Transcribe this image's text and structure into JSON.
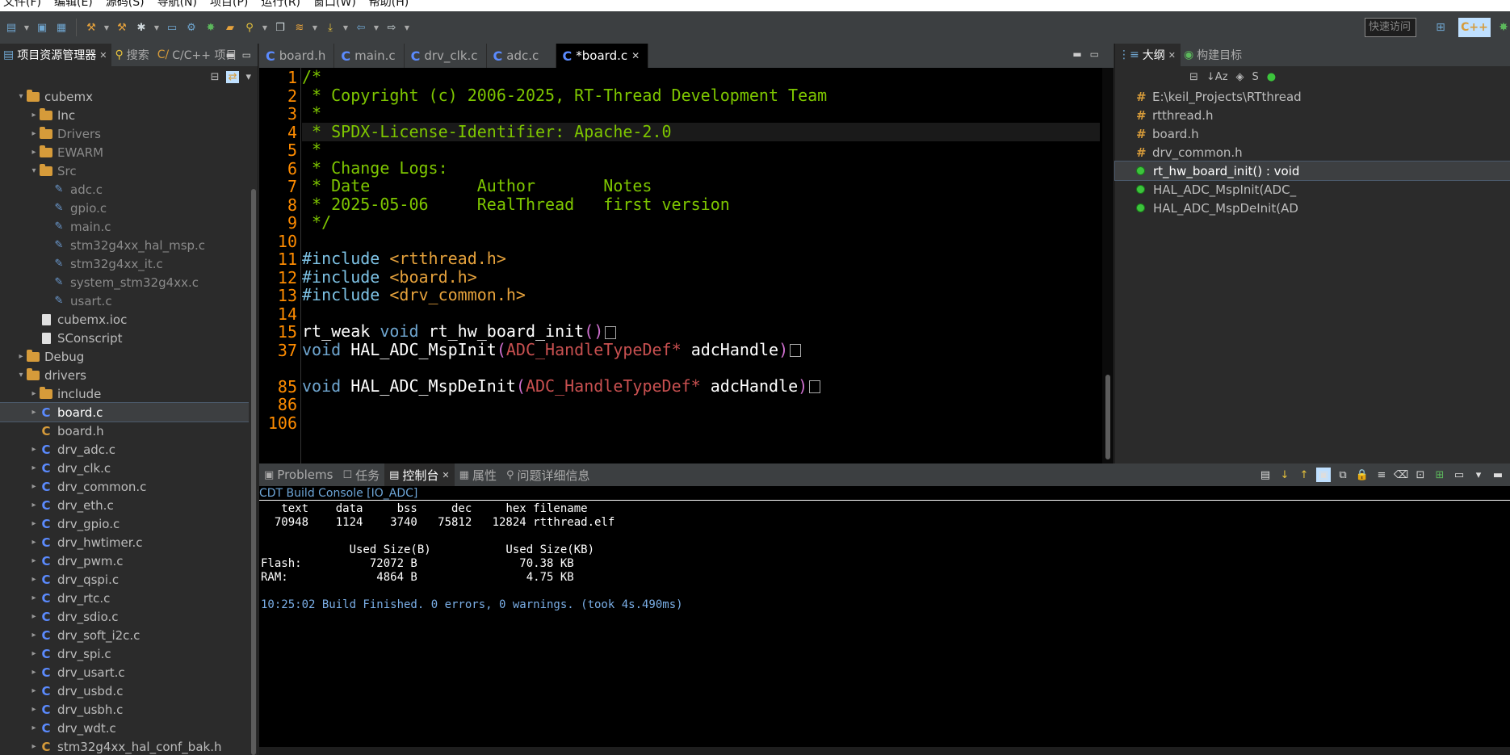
{
  "menu": [
    "文件(F)",
    "编辑(E)",
    "源码(S)",
    "导航(N)",
    "项目(P)",
    "运行(R)",
    "窗口(W)",
    "帮助(H)"
  ],
  "quick_access_placeholder": "快速访问",
  "left_panel": {
    "tabs": [
      {
        "label": "项目资源管理器",
        "active": true
      },
      {
        "label": "搜索",
        "active": false
      },
      {
        "label": "C/C++ 项目",
        "active": false
      }
    ],
    "tree": [
      {
        "label": "cubemx",
        "kind": "folder",
        "level": 1,
        "twisty": "▾"
      },
      {
        "label": "Inc",
        "kind": "folder",
        "level": 2,
        "twisty": "▸"
      },
      {
        "label": "Drivers",
        "kind": "folder",
        "level": 2,
        "twisty": "▸",
        "dim": true
      },
      {
        "label": "EWARM",
        "kind": "folder",
        "level": 2,
        "twisty": "▸",
        "dim": true
      },
      {
        "label": "Src",
        "kind": "folder",
        "level": 2,
        "twisty": "▾",
        "dim": true
      },
      {
        "label": "adc.c",
        "kind": "csrc",
        "level": 3,
        "dim": true
      },
      {
        "label": "gpio.c",
        "kind": "csrc",
        "level": 3,
        "dim": true
      },
      {
        "label": "main.c",
        "kind": "csrc",
        "level": 3,
        "dim": true
      },
      {
        "label": "stm32g4xx_hal_msp.c",
        "kind": "csrc",
        "level": 3,
        "dim": true
      },
      {
        "label": "stm32g4xx_it.c",
        "kind": "csrc",
        "level": 3,
        "dim": true
      },
      {
        "label": "system_stm32g4xx.c",
        "kind": "csrc",
        "level": 3,
        "dim": true
      },
      {
        "label": "usart.c",
        "kind": "csrc",
        "level": 3,
        "dim": true
      },
      {
        "label": "cubemx.ioc",
        "kind": "file",
        "level": 2
      },
      {
        "label": "SConscript",
        "kind": "file",
        "level": 2
      },
      {
        "label": "Debug",
        "kind": "folder",
        "level": 1,
        "twisty": "▸"
      },
      {
        "label": "drivers",
        "kind": "folder",
        "level": 1,
        "twisty": "▾"
      },
      {
        "label": "include",
        "kind": "folder",
        "level": 2,
        "twisty": "▸"
      },
      {
        "label": "board.c",
        "kind": "c",
        "level": 2,
        "twisty": "▸",
        "selected": true
      },
      {
        "label": "board.h",
        "kind": "h",
        "level": 2
      },
      {
        "label": "drv_adc.c",
        "kind": "c",
        "level": 2,
        "twisty": "▸"
      },
      {
        "label": "drv_clk.c",
        "kind": "c",
        "level": 2,
        "twisty": "▸"
      },
      {
        "label": "drv_common.c",
        "kind": "c",
        "level": 2,
        "twisty": "▸"
      },
      {
        "label": "drv_eth.c",
        "kind": "c",
        "level": 2,
        "twisty": "▸"
      },
      {
        "label": "drv_gpio.c",
        "kind": "c",
        "level": 2,
        "twisty": "▸"
      },
      {
        "label": "drv_hwtimer.c",
        "kind": "c",
        "level": 2,
        "twisty": "▸"
      },
      {
        "label": "drv_pwm.c",
        "kind": "c",
        "level": 2,
        "twisty": "▸"
      },
      {
        "label": "drv_qspi.c",
        "kind": "c",
        "level": 2,
        "twisty": "▸"
      },
      {
        "label": "drv_rtc.c",
        "kind": "c",
        "level": 2,
        "twisty": "▸"
      },
      {
        "label": "drv_sdio.c",
        "kind": "c",
        "level": 2,
        "twisty": "▸"
      },
      {
        "label": "drv_soft_i2c.c",
        "kind": "c",
        "level": 2,
        "twisty": "▸"
      },
      {
        "label": "drv_spi.c",
        "kind": "c",
        "level": 2,
        "twisty": "▸"
      },
      {
        "label": "drv_usart.c",
        "kind": "c",
        "level": 2,
        "twisty": "▸"
      },
      {
        "label": "drv_usbd.c",
        "kind": "c",
        "level": 2,
        "twisty": "▸"
      },
      {
        "label": "drv_usbh.c",
        "kind": "c",
        "level": 2,
        "twisty": "▸"
      },
      {
        "label": "drv_wdt.c",
        "kind": "c",
        "level": 2,
        "twisty": "▸"
      },
      {
        "label": "stm32g4xx_hal_conf_bak.h",
        "kind": "h",
        "level": 2,
        "twisty": "▸"
      }
    ]
  },
  "editor": {
    "tabs": [
      {
        "label": "board.h",
        "active": false
      },
      {
        "label": "main.c",
        "active": false
      },
      {
        "label": "drv_clk.c",
        "active": false
      },
      {
        "label": "adc.c",
        "active": false
      },
      {
        "label": "*board.c",
        "active": true
      }
    ],
    "line_numbers": [
      "1",
      "2",
      "3",
      "4",
      "5",
      "6",
      "7",
      "8",
      "9",
      "10",
      "11",
      "12",
      "13",
      "14",
      "15",
      "37",
      "85",
      "86",
      "106"
    ],
    "lines": {
      "l1": "/*",
      "l2": " * Copyright (c) 2006-2025, RT-Thread Development Team",
      "l3": " *",
      "l4": " * SPDX-License-Identifier: Apache-2.0",
      "l5": " *",
      "l6": " * Change Logs:",
      "l7": " * Date           Author       Notes",
      "l8": " * 2025-05-06     RealThread   first version",
      "l9": " */",
      "inc_kw": "#include",
      "inc1": "<rtthread.h>",
      "inc2": "<board.h>",
      "inc3": "<drv_common.h>",
      "l15_weak": "rt_weak",
      "void_kw": "void",
      "l15_fn": "rt_hw_board_init",
      "empty_parens": "()",
      "msp_init": "HAL_ADC_MspInit",
      "msp_deinit": "HAL_ADC_MspDeInit",
      "lparen": "(",
      "rparen": ")",
      "adc_type": "ADC_HandleTypeDef",
      "star": "*",
      "adc_param": "adcHandle"
    }
  },
  "outline": {
    "tabs": [
      {
        "label": "大纲",
        "active": true
      },
      {
        "label": "构建目标",
        "active": false
      }
    ],
    "items": [
      {
        "label": "E:\\keil_Projects\\RTthread",
        "kind": "include"
      },
      {
        "label": "rtthread.h",
        "kind": "include"
      },
      {
        "label": "board.h",
        "kind": "include"
      },
      {
        "label": "drv_common.h",
        "kind": "include"
      },
      {
        "label": "rt_hw_board_init() : void",
        "kind": "function",
        "selected": true
      },
      {
        "label": "HAL_ADC_MspInit(ADC_",
        "kind": "function"
      },
      {
        "label": "HAL_ADC_MspDeInit(AD",
        "kind": "function"
      }
    ]
  },
  "console": {
    "tabs": [
      {
        "label": "Problems",
        "active": false
      },
      {
        "label": "任务",
        "active": false
      },
      {
        "label": "控制台",
        "active": true
      },
      {
        "label": "属性",
        "active": false
      },
      {
        "label": "问题详细信息",
        "active": false
      }
    ],
    "title": "CDT Build Console [IO_ADC]",
    "output": "   text    data     bss     dec     hex filename\n  70948    1124    3740   75812   12824 rtthread.elf\n\n             Used Size(B)           Used Size(KB)\nFlash:          72072 B               70.38 KB\nRAM:             4864 B                4.75 KB\n",
    "finish": "10:25:02 Build Finished. 0 errors, 0 warnings. (took 4s.490ms)"
  }
}
